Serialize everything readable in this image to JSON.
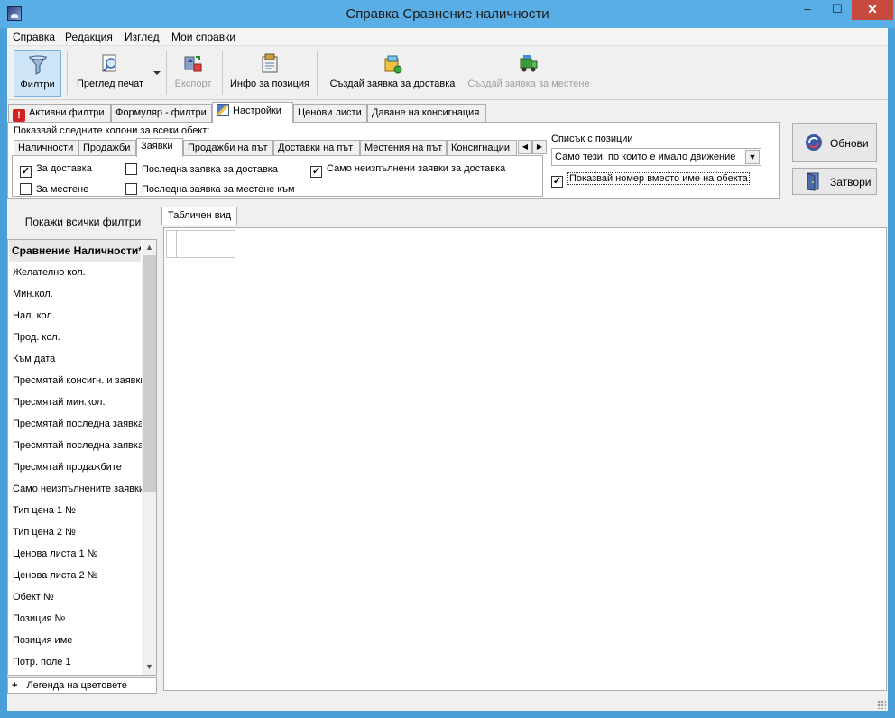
{
  "window": {
    "title": "Справка Сравнение наличности"
  },
  "menu": [
    "Справка",
    "Редакция",
    "Изглед",
    "Мои справки"
  ],
  "toolbar": {
    "filters": "Филтри",
    "print_preview": "Преглед печат",
    "export": "Експорт",
    "item_info": "Инфо за позиция",
    "create_delivery": "Създай заявка за доставка",
    "create_transfer": "Създай заявка за местене"
  },
  "tabs": [
    "Активни филтри",
    "Формуляр - филтри",
    "Настройки",
    "Ценови листи",
    "Даване на консигнация"
  ],
  "settings": {
    "label": "Показвай следните колони за всеки обект:",
    "inner_tabs": [
      "Наличности",
      "Продажби",
      "Заявки",
      "Продажби на път",
      "Доставки на път",
      "Местения на път",
      "Консигнации"
    ],
    "checks": {
      "for_delivery": "За доставка",
      "for_transfer": "За местене",
      "last_delivery": "Последна заявка за доставка",
      "last_transfer": "Последна заявка за местене към",
      "only_unfulfilled": "Само неизпълнени заявки за доставка"
    },
    "list_label": "Списък с позиции",
    "list_value": "Само тези, по които е имало движение",
    "show_number": "Показвай номер вместо име на обекта"
  },
  "buttons": {
    "refresh": "Обнови",
    "close": "Затвори"
  },
  "filter_panel": {
    "header": "Покажи всички филтри",
    "items": [
      "Сравнение Наличности*",
      "Желателно кол.",
      "Мин.кол.",
      "Нал. кол.",
      "Прод. кол.",
      "Към дата",
      "Пресмятай консигн. и заявки",
      "Пресмятай мин.кол.",
      "Пресмятай последна заявка",
      "Пресмятай последна заявка",
      "Пресмятай продажбите",
      "Само неизпълнените заявки",
      "Тип цена 1 №",
      "Тип цена 2 №",
      "Ценова листа 1 №",
      "Ценова листа 2 №",
      "Обект №",
      "Позиция №",
      "Позиция име",
      "Потр. поле 1"
    ],
    "legend": "Легенда на цветовете",
    "legend_plus": "+"
  },
  "grid": {
    "tab": "Табличен вид"
  }
}
